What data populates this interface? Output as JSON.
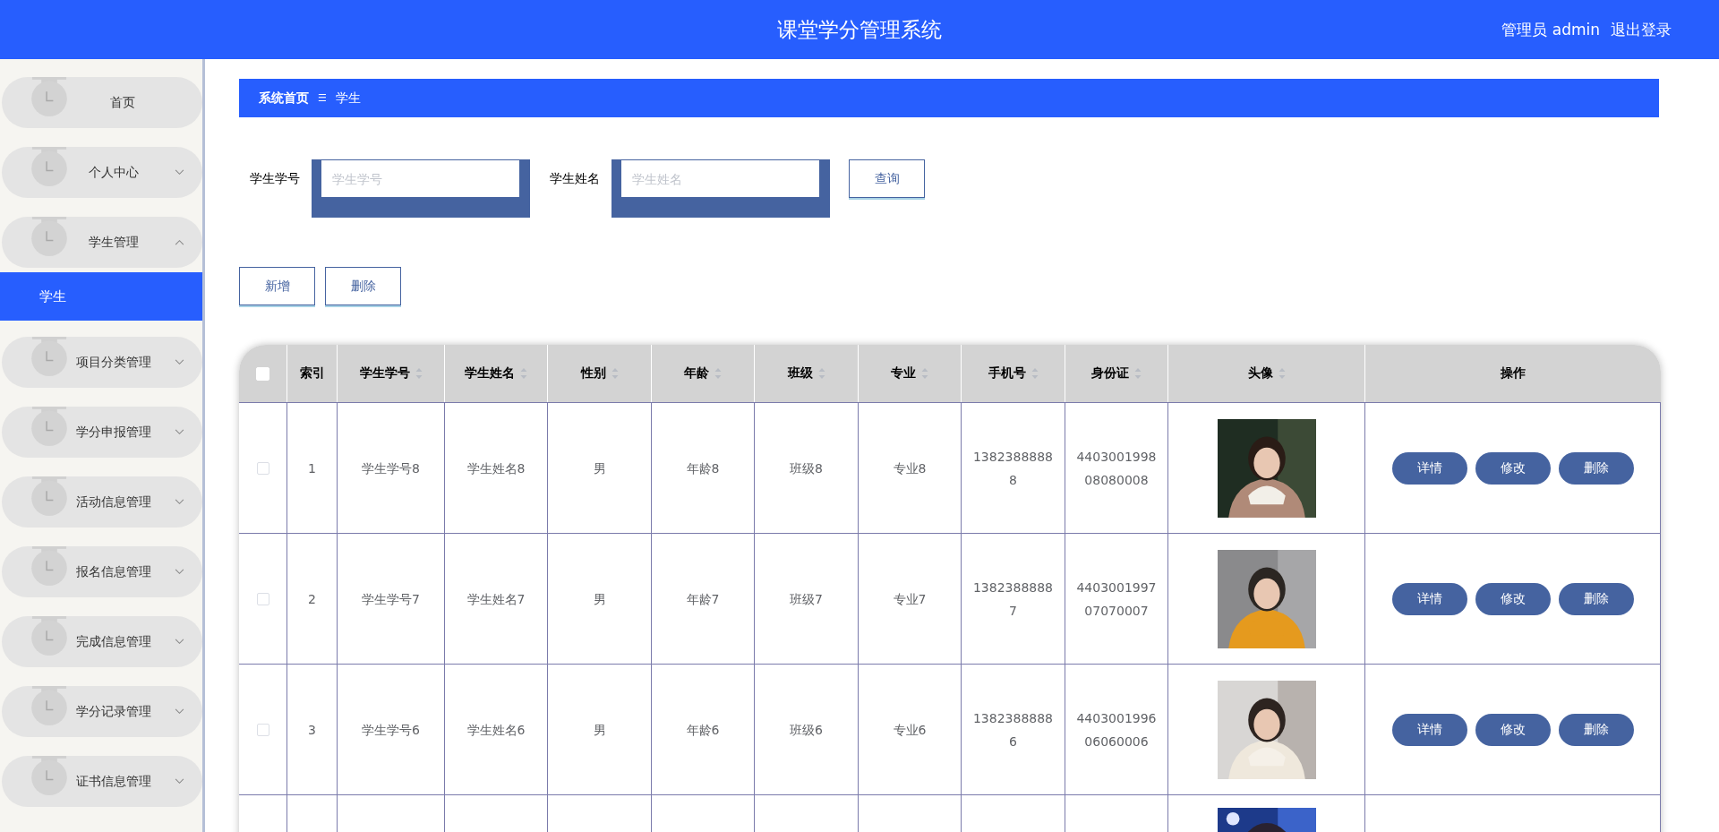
{
  "header": {
    "title": "课堂学分管理系统",
    "user": "管理员 admin",
    "logout": "退出登录"
  },
  "sidebar": {
    "items": [
      {
        "label": "首页",
        "kind": "link"
      },
      {
        "label": "个人中心",
        "kind": "group",
        "expanded": false
      },
      {
        "label": "学生管理",
        "kind": "group",
        "expanded": true,
        "children": [
          {
            "label": "学生",
            "selected": true
          }
        ]
      },
      {
        "label": "项目分类管理",
        "kind": "group",
        "expanded": false
      },
      {
        "label": "学分申报管理",
        "kind": "group",
        "expanded": false
      },
      {
        "label": "活动信息管理",
        "kind": "group",
        "expanded": false
      },
      {
        "label": "报名信息管理",
        "kind": "group",
        "expanded": false
      },
      {
        "label": "完成信息管理",
        "kind": "group",
        "expanded": false
      },
      {
        "label": "学分记录管理",
        "kind": "group",
        "expanded": false
      },
      {
        "label": "证书信息管理",
        "kind": "group",
        "expanded": false
      }
    ]
  },
  "breadcrumb": {
    "items": [
      "系统首页",
      "学生"
    ],
    "separator": "☰"
  },
  "search": {
    "fields": [
      {
        "label": "学生学号",
        "placeholder": "学生学号"
      },
      {
        "label": "学生姓名",
        "placeholder": "学生姓名"
      }
    ],
    "button": "查询"
  },
  "actions": [
    "新增",
    "删除"
  ],
  "table": {
    "select_all": {
      "checked": false
    },
    "columns": [
      {
        "label": "索引",
        "sortable": false
      },
      {
        "label": "学生学号",
        "sortable": true
      },
      {
        "label": "学生姓名",
        "sortable": true
      },
      {
        "label": "性别",
        "sortable": true
      },
      {
        "label": "年龄",
        "sortable": true
      },
      {
        "label": "班级",
        "sortable": true
      },
      {
        "label": "专业",
        "sortable": true
      },
      {
        "label": "手机号",
        "sortable": true
      },
      {
        "label": "身份证",
        "sortable": true
      },
      {
        "label": "头像",
        "sortable": true
      },
      {
        "label": "操作",
        "sortable": false
      }
    ],
    "rows": [
      {
        "checked": false,
        "cells": [
          "1",
          "学生学号8",
          "学生姓名8",
          "男",
          "年龄8",
          "班级8",
          "专业8",
          "13823888888",
          "440300199808080008"
        ],
        "avatar": {
          "kind": "picture"
        },
        "buttons": [
          "详情",
          "修改",
          "删除"
        ]
      },
      {
        "checked": false,
        "cells": [
          "2",
          "学生学号7",
          "学生姓名7",
          "男",
          "年龄7",
          "班级7",
          "专业7",
          "13823888887",
          "440300199707070007"
        ],
        "avatar": {
          "kind": "picture"
        },
        "buttons": [
          "详情",
          "修改",
          "删除"
        ]
      },
      {
        "checked": false,
        "cells": [
          "3",
          "学生学号6",
          "学生姓名6",
          "男",
          "年龄6",
          "班级6",
          "专业6",
          "13823888886",
          "440300199606060006"
        ],
        "avatar": {
          "kind": "picture"
        },
        "buttons": [
          "详情",
          "修改",
          "删除"
        ]
      }
    ]
  }
}
